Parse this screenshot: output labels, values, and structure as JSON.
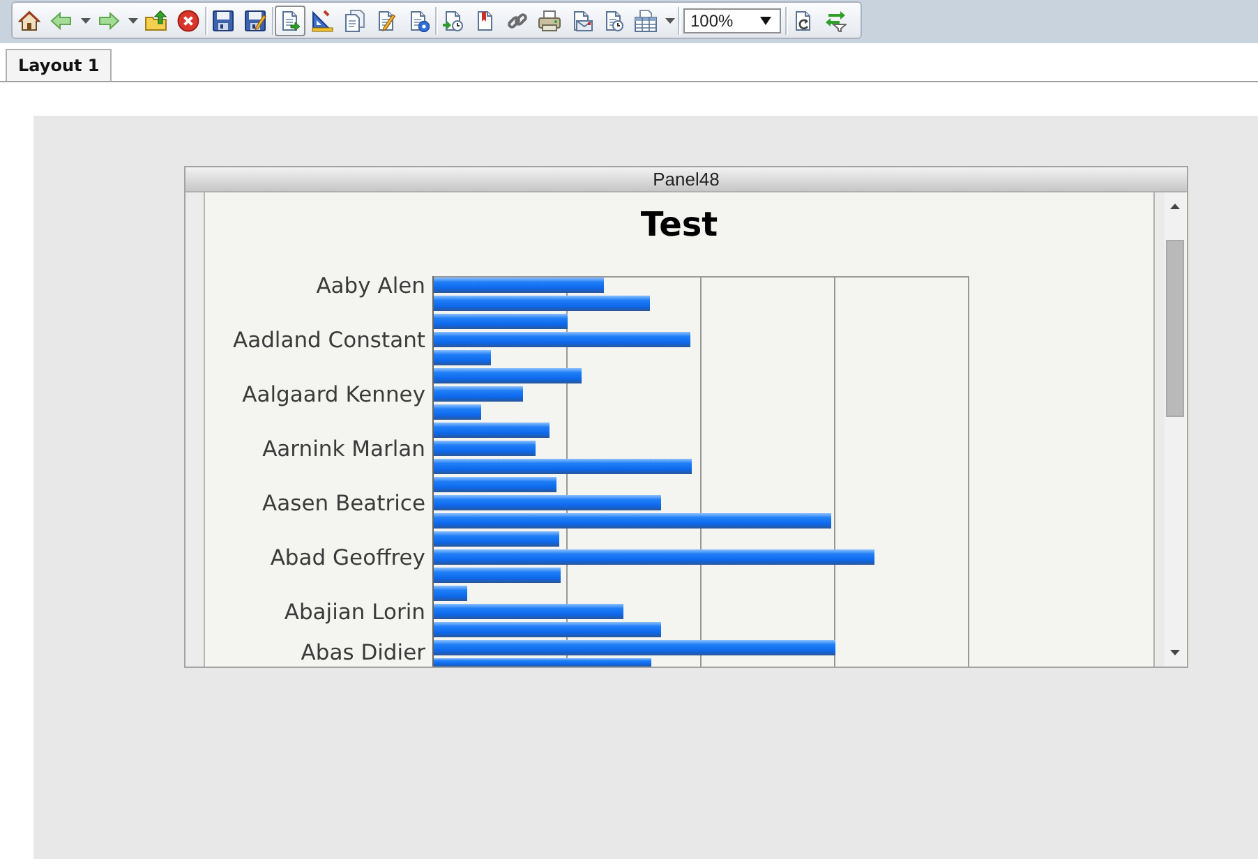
{
  "toolbar": {
    "items": [
      {
        "kind": "button",
        "pressed": false
      },
      {
        "kind": "split",
        "pressed": false
      },
      {
        "kind": "split",
        "pressed": false
      },
      {
        "kind": "button",
        "pressed": false
      },
      {
        "kind": "button",
        "pressed": false
      },
      {
        "kind": "separator"
      },
      {
        "kind": "button",
        "pressed": false
      },
      {
        "kind": "button",
        "pressed": false
      },
      {
        "kind": "separator"
      },
      {
        "kind": "button",
        "pressed": true
      },
      {
        "kind": "button",
        "pressed": false
      },
      {
        "kind": "button",
        "pressed": false
      },
      {
        "kind": "button",
        "pressed": false
      },
      {
        "kind": "button",
        "pressed": false
      },
      {
        "kind": "separator"
      },
      {
        "kind": "button",
        "pressed": false
      },
      {
        "kind": "button",
        "pressed": false
      },
      {
        "kind": "button",
        "pressed": false
      },
      {
        "kind": "button",
        "pressed": false
      },
      {
        "kind": "button",
        "pressed": false
      },
      {
        "kind": "button",
        "pressed": false
      },
      {
        "kind": "split",
        "pressed": false
      },
      {
        "kind": "separator"
      },
      {
        "kind": "select",
        "value": "100%"
      },
      {
        "kind": "separator"
      },
      {
        "kind": "button",
        "pressed": false
      },
      {
        "kind": "button",
        "pressed": false
      }
    ]
  },
  "tabs": [
    {
      "label": "Layout 1",
      "selected": true
    }
  ],
  "panel": {
    "title": "Panel48",
    "chart": {
      "title": "Test",
      "labels": [
        "Aaby Alen",
        "Aadland Constant",
        "Aalgaard Kenney",
        "Aarnink Marlan",
        "Aasen Beatrice",
        "Abad Geoffrey",
        "Abajian Lorin",
        "Abas Didier"
      ]
    }
  }
}
